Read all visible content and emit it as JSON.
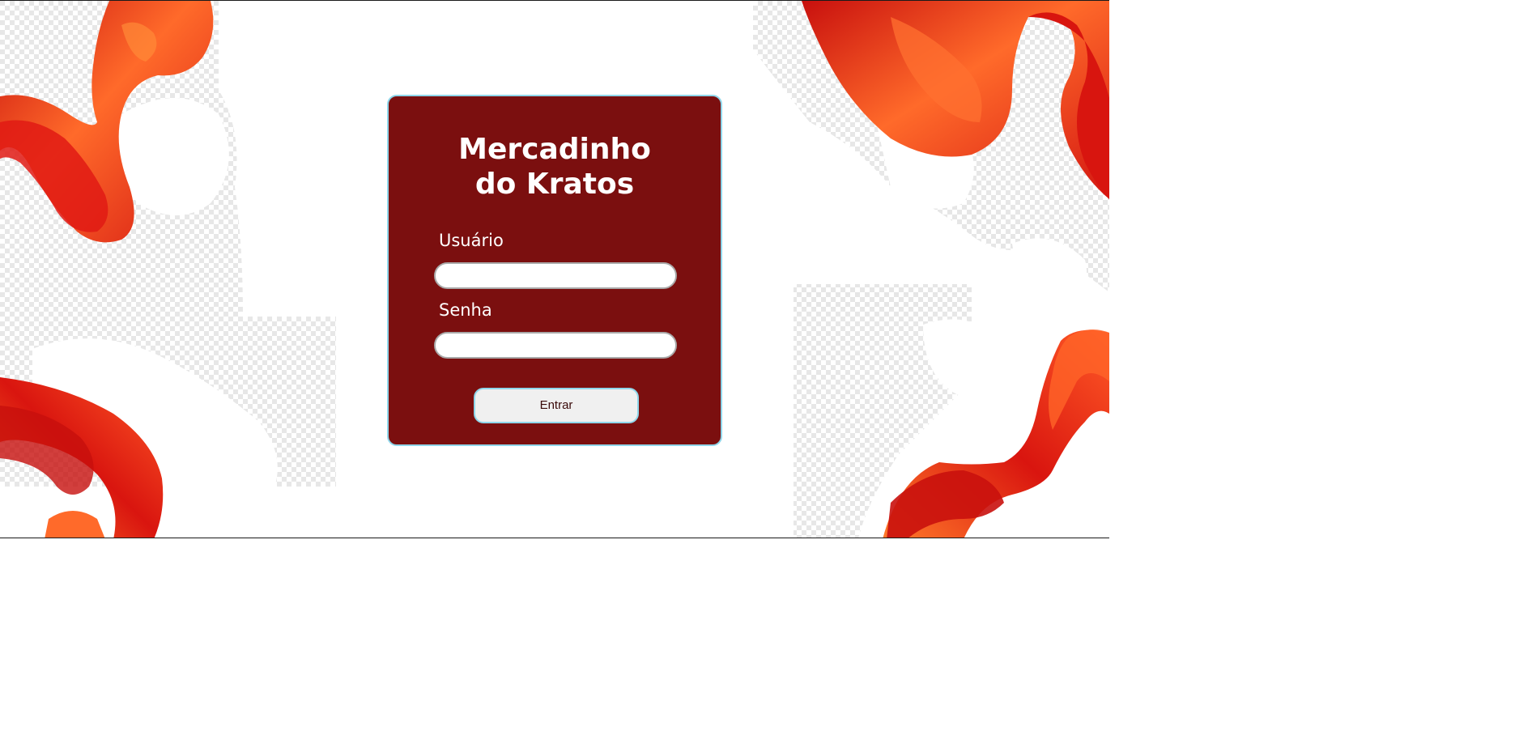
{
  "login": {
    "title_line1": "Mercadinho",
    "title_line2": "do Kratos",
    "username_label": "Usuário",
    "username_value": "",
    "password_label": "Senha",
    "password_value": "",
    "submit_label": "Entrar"
  },
  "background": {
    "decoration": "red-silk-ribbons",
    "pattern": "transparency-checkerboard"
  },
  "colors": {
    "card": "#7b0f0f",
    "card_border": "#8fd6ea",
    "ribbon": "#e8241a",
    "ribbon_highlight": "#ff7a2a",
    "button": "#f0f0f0"
  }
}
